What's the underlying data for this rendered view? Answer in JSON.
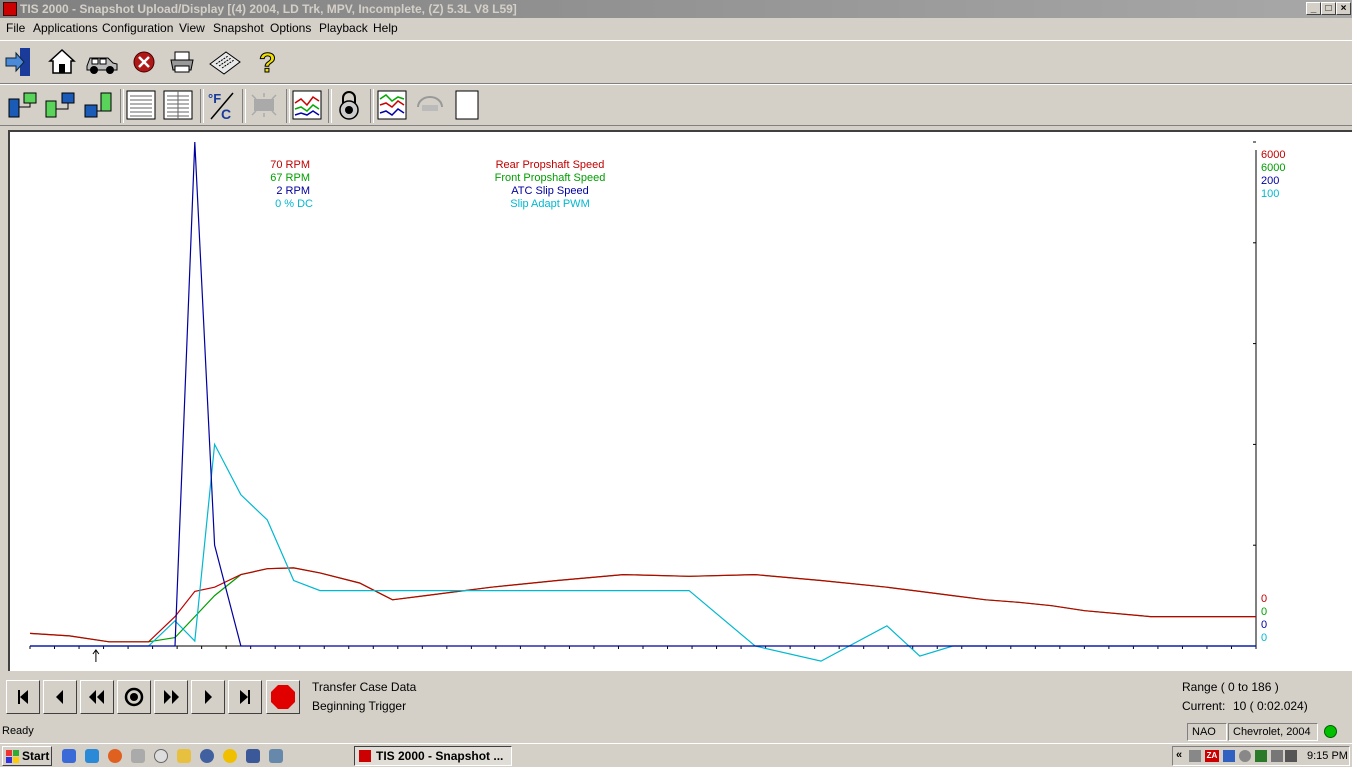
{
  "window": {
    "title": "TIS 2000 - Snapshot Upload/Display [(4) 2004, LD Trk, MPV, Incomplete, (Z) 5.3L   V8 L59]"
  },
  "menu": [
    "File",
    "Applications",
    "Configuration",
    "View",
    "Snapshot",
    "Options",
    "Playback",
    "Help"
  ],
  "toolbar1": [
    "exit-icon",
    "home-icon",
    "vehicle-icon",
    "stop-icon",
    "print-icon",
    "keyboard-icon",
    "help-icon"
  ],
  "toolbar2": [
    "connect-icon",
    "transfer-icon",
    "upload-icon",
    "table-view-icon",
    "column-view-icon",
    "units-fc-icon",
    "display-icon",
    "graph-icon",
    "lock-icon",
    "multi-graph-icon",
    "compare-icon",
    "blank-page-icon"
  ],
  "chart": {
    "colors": {
      "rear": "#c00000",
      "front": "#00a000",
      "atc": "#0000a0",
      "pwm": "#00b8d0"
    },
    "left_labels": [
      "70 RPM",
      "67 RPM",
      "2 RPM",
      "0 % DC"
    ],
    "legend": [
      "Rear Propshaft Speed",
      "Front Propshaft Speed",
      "ATC Slip Speed",
      "Slip Adapt PWM"
    ],
    "scale_max": [
      "6000",
      "6000",
      "200",
      "100"
    ],
    "scale_min": [
      "0",
      "0",
      "0",
      "0"
    ]
  },
  "chart_data": {
    "type": "line",
    "x": [
      0,
      6,
      12,
      18,
      22,
      25,
      28,
      32,
      36,
      40,
      44,
      50,
      55,
      60,
      70,
      80,
      90,
      100,
      110,
      120,
      130,
      135,
      140,
      145,
      150,
      155,
      160,
      170,
      186
    ],
    "series": [
      {
        "name": "Rear Propshaft Speed",
        "values": [
          150,
          120,
          50,
          50,
          350,
          650,
          700,
          850,
          920,
          930,
          870,
          750,
          550,
          600,
          700,
          780,
          850,
          830,
          850,
          780,
          700,
          650,
          600,
          550,
          520,
          480,
          420,
          350,
          350
        ]
      },
      {
        "name": "Front Propshaft Speed",
        "values": [
          150,
          120,
          50,
          50,
          100,
          350,
          600,
          850,
          920,
          930,
          870,
          750,
          550,
          600,
          700,
          780,
          850,
          830,
          850,
          780,
          700,
          650,
          600,
          550,
          520,
          480,
          420,
          350,
          350
        ]
      },
      {
        "name": "ATC Slip Speed",
        "values": [
          0,
          0,
          0,
          0,
          0,
          200,
          40,
          0,
          0,
          0,
          0,
          0,
          0,
          0,
          0,
          0,
          0,
          0,
          0,
          0,
          0,
          0,
          0,
          0,
          0,
          0,
          0,
          0,
          0
        ]
      },
      {
        "name": "Slip Adapt PWM",
        "values": [
          0,
          0,
          0,
          0,
          5,
          1,
          40,
          30,
          25,
          13,
          11,
          11,
          11,
          11,
          11,
          11,
          11,
          11,
          0,
          -3,
          4,
          -2,
          0,
          0,
          0,
          0,
          0,
          0,
          0
        ]
      }
    ],
    "xlim": [
      0,
      186
    ],
    "marker_index": 10
  },
  "controls": {
    "buttons": [
      "skip-start-icon",
      "step-back-icon",
      "rewind-icon",
      "record-icon",
      "fast-forward-icon",
      "step-forward-icon",
      "skip-end-icon",
      "stop-red-icon"
    ],
    "data_label": "Transfer Case Data",
    "trigger_label": "Beginning Trigger",
    "range": "Range ( 0 to 186 )",
    "current_label": "Current:",
    "current_value": "10 ( 0:02.024)"
  },
  "status": {
    "text": "Ready",
    "region": "NAO",
    "vehicle": "Chevrolet, 2004"
  },
  "taskbar": {
    "start": "Start",
    "task": "TIS 2000 - Snapshot ...",
    "clock": "9:15 PM"
  }
}
